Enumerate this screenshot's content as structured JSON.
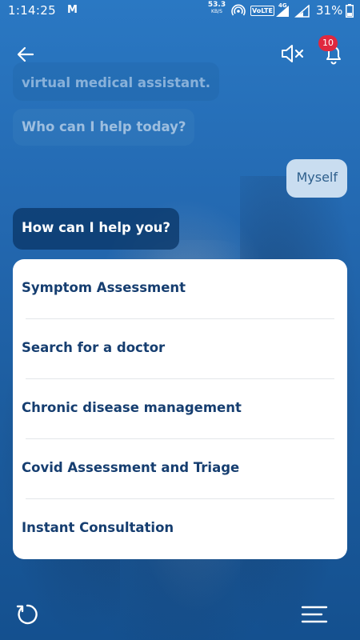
{
  "status_bar": {
    "time": "1:14:25",
    "carrier_logo": "M",
    "speed_value": "53.3",
    "speed_unit": "KB/S",
    "volte": "VoLTE",
    "network": "4G",
    "battery": "31%"
  },
  "header": {
    "back_icon": "arrow-left-icon",
    "mute_icon": "speaker-muted-icon",
    "bell_icon": "bell-icon",
    "notification_count": "10"
  },
  "chat": {
    "messages": [
      {
        "from": "bot",
        "text": "virtual medical assistant."
      },
      {
        "from": "bot",
        "text": "Who can I help today?"
      },
      {
        "from": "user",
        "text": "Myself"
      },
      {
        "from": "bot",
        "text": "How can I help you?"
      }
    ]
  },
  "options": [
    {
      "label": "Symptom Assessment"
    },
    {
      "label": "Search for a doctor"
    },
    {
      "label": "Chronic disease management"
    },
    {
      "label": "Covid Assessment and Triage"
    },
    {
      "label": "Instant Consultation"
    }
  ],
  "footer": {
    "refresh_icon": "refresh-icon",
    "menu_icon": "hamburger-menu-icon"
  },
  "colors": {
    "background": "#1f63a8",
    "option_text": "#163e70",
    "badge": "#e0283f",
    "user_bubble": "#c9ddf0"
  }
}
